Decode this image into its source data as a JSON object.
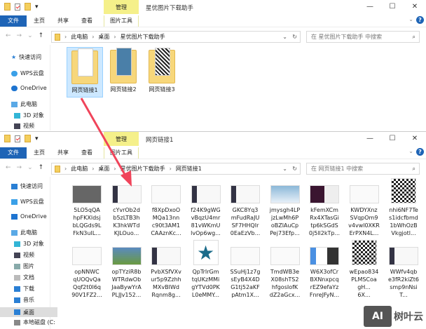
{
  "ribbon": {
    "manage": "管理",
    "file": "文件",
    "home": "主页",
    "share": "共享",
    "view": "查看",
    "picture_tools": "图片工具"
  },
  "window1": {
    "title": "星优图片下载助手",
    "path": [
      "此电脑",
      "桌面",
      "星优图片下载助手"
    ],
    "search_placeholder": "在 星优图片下载助手 中搜索",
    "folders": [
      {
        "name": "网页链接1",
        "selected": true
      },
      {
        "name": "网页链接2"
      },
      {
        "name": "网页链接3"
      }
    ],
    "sidebar": [
      "快速访问",
      "WPS云盘",
      "OneDrive",
      "此电脑",
      "3D 对象",
      "视频"
    ]
  },
  "window2": {
    "title": "网页链接1",
    "path": [
      "此电脑",
      "桌面",
      "星优图片下载助手",
      "网页链接1"
    ],
    "search_placeholder": "在 网页链接1 中搜索",
    "sidebar": [
      "快速访问",
      "WPS云盘",
      "OneDrive",
      "此电脑",
      "3D 对象",
      "视频",
      "图片",
      "文档",
      "下载",
      "音乐",
      "桌面",
      "本地磁盘 (C:"
    ],
    "files": [
      {
        "name": [
          "5LO5qQA",
          "hpFKXldsj",
          "bLQGds9L",
          "FkN3uIL..."
        ],
        "thumb": "dark"
      },
      {
        "name": [
          "cYvrOb2d",
          "b5zLTB3h",
          "K3hkWTd",
          "KJLOuo..."
        ],
        "thumb": "app"
      },
      {
        "name": [
          "f8XpDxoO",
          "MQa13nn",
          "c90t3AM1",
          "CAAznKc..."
        ],
        "thumb": "web"
      },
      {
        "name": [
          "f24K9gWG",
          "vBqzU4mr",
          "81vWKmU",
          "lvOp6wg..."
        ],
        "thumb": "app"
      },
      {
        "name": [
          "GKC8Yq3",
          "mFudRaJU",
          "SF7HHQIr",
          "0EaEzVb..."
        ],
        "thumb": "app"
      },
      {
        "name": [
          "jmysgh4LP",
          "jzLwMh6P",
          "oBZlAuCp",
          "Pej73Efp..."
        ],
        "thumb": "sky"
      },
      {
        "name": [
          "kFemXCm",
          "Rx4XTasGi",
          "tp6kSGdS",
          "0j5ll2kTp..."
        ],
        "thumb": "term"
      },
      {
        "name": [
          "KWDYXnz",
          "SVqpOm9",
          "v4vwl0XKR",
          "ErPXN4L..."
        ],
        "thumb": "web"
      },
      {
        "name": [
          "nhi6NF7Te",
          "s1idcfbmd",
          "1bWhOzB",
          "Vkgjotl..."
        ],
        "thumb": "qr"
      },
      {
        "name": [
          "opNNWC",
          "qUOQvQa",
          "Qqf2t0I6q",
          "90V1FZ2..."
        ],
        "thumb": "web"
      },
      {
        "name": [
          "opTYziR8b",
          "WTRdwOb",
          "JaaBywYrA",
          "PLJJv152..."
        ],
        "thumb": "photo"
      },
      {
        "name": [
          "PvbXSfVXv",
          "ur5p9Zzhh",
          "MXvBIWd",
          "Rqnm8g..."
        ],
        "thumb": "app"
      },
      {
        "name": [
          "QpTrIrGm",
          "tqUKzMMi",
          "gYTVd0PK",
          "L0eMMY..."
        ],
        "thumb": "star"
      },
      {
        "name": [
          "SSuHj1z7g",
          "sEyB4X4D",
          "G1tj52aKF",
          "pAtm1X..."
        ],
        "thumb": "web"
      },
      {
        "name": [
          "TmdWB3e",
          "X08shTS2",
          "hfgosIofK",
          "dZ2aGcx..."
        ],
        "thumb": "web"
      },
      {
        "name": [
          "W6X3ofCr",
          "BXNnxpcq",
          "rEZ9efaYz",
          "FnreJFyN..."
        ],
        "thumb": "colors"
      },
      {
        "name": [
          "wEpao834",
          "PLMSCoa",
          "gH...",
          "6X..."
        ],
        "thumb": "qr"
      },
      {
        "name": [
          "WWfv4qb",
          "e3fR2kiZt6",
          "smp9nNsi",
          "T..."
        ],
        "thumb": "app"
      }
    ]
  },
  "watermark": {
    "logo": "AI",
    "text": "树叶云"
  },
  "colors": {
    "accent": "#1e64b6",
    "manage": "#f5f08a",
    "arrow": "#f0445a"
  }
}
